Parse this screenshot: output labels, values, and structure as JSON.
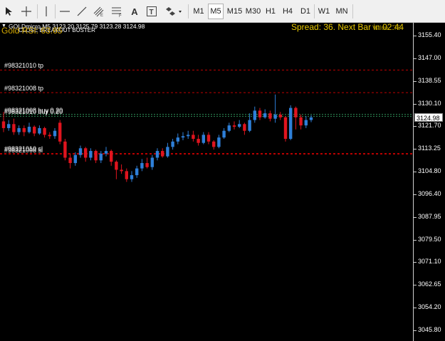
{
  "toolbar": {
    "tools": [
      {
        "name": "cursor-tool",
        "icon": "arrow-cursor-icon"
      },
      {
        "name": "crosshair-tool",
        "icon": "crosshair-icon"
      },
      {
        "name": "vertical-line-tool",
        "icon": "vertical-line-icon"
      },
      {
        "name": "horizontal-line-tool",
        "icon": "horizontal-line-icon"
      },
      {
        "name": "trendline-tool",
        "icon": "trendline-icon"
      },
      {
        "name": "equidistant-channel-tool",
        "icon": "channel-icon"
      },
      {
        "name": "fibonacci-tool",
        "icon": "fibonacci-icon"
      },
      {
        "name": "text-tool",
        "icon": "text-icon",
        "label": "A"
      },
      {
        "name": "text-label-tool",
        "icon": "text-label-icon",
        "label": "T"
      },
      {
        "name": "shapes-tool",
        "icon": "shapes-icon"
      }
    ],
    "timeframes": [
      "M1",
      "M5",
      "M15",
      "M30",
      "H1",
      "H4",
      "D1",
      "W1",
      "MN"
    ],
    "active_timeframe": "M5"
  },
  "chart": {
    "symbol_info": "GOLDmicro,M5  3123.20 3125.79 3123.28 3124.98",
    "indicator_name": "CLOSE BREAKOUT BUSTER",
    "rsi_text": "Gold RSI: 63.65",
    "spread_text": "Spread: 36. Next Bar in 02:44",
    "value_text": "Value : 76",
    "current_price": "3124.98",
    "price_min": 3042.0,
    "price_max": 3161.0,
    "axis_labels": [
      "3155.40",
      "3147.00",
      "3138.55",
      "3130.10",
      "3121.70",
      "3113.25",
      "3104.80",
      "3096.40",
      "3087.95",
      "3079.50",
      "3071.10",
      "3062.65",
      "3054.20",
      "3045.80"
    ],
    "colors": {
      "bull": "#2e7fd8",
      "bear": "#e0141e",
      "tp_line": "#c00000",
      "entry_line": "#2e8b57",
      "sl_line": "#c00000"
    },
    "orders": [
      {
        "label": "#98321010 tp",
        "price": 3142.6,
        "type": "tp"
      },
      {
        "label": "#98321008 tp",
        "price": 3134.2,
        "type": "tp"
      },
      {
        "label": "#98321008 buy 0.20",
        "price": 3126.1,
        "type": "entry"
      },
      {
        "label": "#98321010 buy 0.20",
        "price": 3125.4,
        "type": "entry"
      },
      {
        "label": "#98321008 sl",
        "price": 3111.3,
        "type": "sl"
      },
      {
        "label": "#98321010 sl",
        "price": 3111.6,
        "type": "sl"
      }
    ]
  },
  "chart_data": {
    "type": "candlestick",
    "candles": [
      [
        3123.5,
        3121.0,
        3127.0,
        3119.5
      ],
      [
        3121.0,
        3122.5,
        3124.0,
        3120.0
      ],
      [
        3122.5,
        3119.5,
        3124.5,
        3118.5
      ],
      [
        3119.5,
        3121.0,
        3122.0,
        3118.5
      ],
      [
        3121.0,
        3119.5,
        3122.0,
        3118.0
      ],
      [
        3119.5,
        3121.5,
        3123.0,
        3119.0
      ],
      [
        3121.5,
        3119.0,
        3122.0,
        3118.0
      ],
      [
        3119.0,
        3121.0,
        3122.0,
        3118.5
      ],
      [
        3121.0,
        3118.5,
        3121.5,
        3117.5
      ],
      [
        3118.5,
        3118.0,
        3119.5,
        3117.0
      ],
      [
        3118.0,
        3120.0,
        3121.0,
        3117.0
      ],
      [
        3123.0,
        3116.0,
        3124.0,
        3115.0
      ],
      [
        3116.0,
        3110.0,
        3117.0,
        3109.0
      ],
      [
        3110.0,
        3108.0,
        3111.5,
        3106.0
      ],
      [
        3108.0,
        3111.0,
        3112.0,
        3107.0
      ],
      [
        3111.0,
        3113.5,
        3114.5,
        3110.0
      ],
      [
        3113.5,
        3110.0,
        3114.0,
        3108.5
      ],
      [
        3110.0,
        3112.5,
        3113.5,
        3109.0
      ],
      [
        3112.5,
        3109.0,
        3113.0,
        3108.0
      ],
      [
        3109.0,
        3111.5,
        3112.5,
        3108.0
      ],
      [
        3111.5,
        3112.5,
        3114.0,
        3110.5
      ],
      [
        3112.5,
        3108.5,
        3113.0,
        3107.0
      ],
      [
        3108.5,
        3105.5,
        3109.0,
        3102.0
      ],
      [
        3105.5,
        3105.0,
        3107.5,
        3104.0
      ],
      [
        3105.0,
        3102.0,
        3106.0,
        3101.0
      ],
      [
        3102.0,
        3103.5,
        3105.0,
        3101.0
      ],
      [
        3103.5,
        3106.0,
        3107.0,
        3102.5
      ],
      [
        3106.0,
        3108.0,
        3109.5,
        3105.0
      ],
      [
        3108.0,
        3106.5,
        3110.0,
        3106.0
      ],
      [
        3106.5,
        3110.0,
        3111.0,
        3105.5
      ],
      [
        3110.0,
        3112.5,
        3113.5,
        3109.0
      ],
      [
        3112.5,
        3110.5,
        3113.5,
        3110.0
      ],
      [
        3110.5,
        3114.0,
        3115.5,
        3110.0
      ],
      [
        3114.0,
        3116.0,
        3117.0,
        3113.0
      ],
      [
        3116.0,
        3117.5,
        3119.0,
        3115.0
      ],
      [
        3117.5,
        3118.0,
        3119.5,
        3116.5
      ],
      [
        3118.0,
        3118.5,
        3120.0,
        3117.0
      ],
      [
        3118.5,
        3117.0,
        3120.0,
        3116.0
      ],
      [
        3117.0,
        3115.5,
        3118.5,
        3114.5
      ],
      [
        3115.5,
        3118.5,
        3119.5,
        3115.0
      ],
      [
        3118.5,
        3116.0,
        3119.5,
        3115.0
      ],
      [
        3116.0,
        3114.0,
        3116.5,
        3113.0
      ],
      [
        3114.0,
        3117.5,
        3118.5,
        3113.5
      ],
      [
        3117.5,
        3120.0,
        3121.0,
        3117.0
      ],
      [
        3120.0,
        3122.0,
        3123.0,
        3119.5
      ],
      [
        3122.0,
        3121.5,
        3123.5,
        3120.5
      ],
      [
        3121.5,
        3122.5,
        3124.0,
        3121.0
      ],
      [
        3122.5,
        3120.0,
        3123.0,
        3118.5
      ],
      [
        3120.0,
        3124.0,
        3126.5,
        3119.5
      ],
      [
        3124.0,
        3127.5,
        3129.0,
        3123.0
      ],
      [
        3127.5,
        3125.0,
        3128.5,
        3124.0
      ],
      [
        3125.0,
        3126.5,
        3128.0,
        3124.5
      ],
      [
        3126.5,
        3124.5,
        3127.5,
        3123.5
      ],
      [
        3124.5,
        3126.0,
        3133.5,
        3123.0
      ],
      [
        3126.0,
        3125.0,
        3127.0,
        3124.0
      ],
      [
        3125.0,
        3117.0,
        3125.5,
        3116.0
      ],
      [
        3117.0,
        3128.5,
        3129.5,
        3116.5
      ],
      [
        3128.5,
        3125.0,
        3129.0,
        3120.5
      ],
      [
        3125.0,
        3122.0,
        3126.0,
        3120.5
      ],
      [
        3122.0,
        3124.0,
        3125.5,
        3121.0
      ],
      [
        3124.0,
        3124.98,
        3125.79,
        3123.2
      ]
    ],
    "ylim": [
      3042.0,
      3161.0
    ]
  }
}
